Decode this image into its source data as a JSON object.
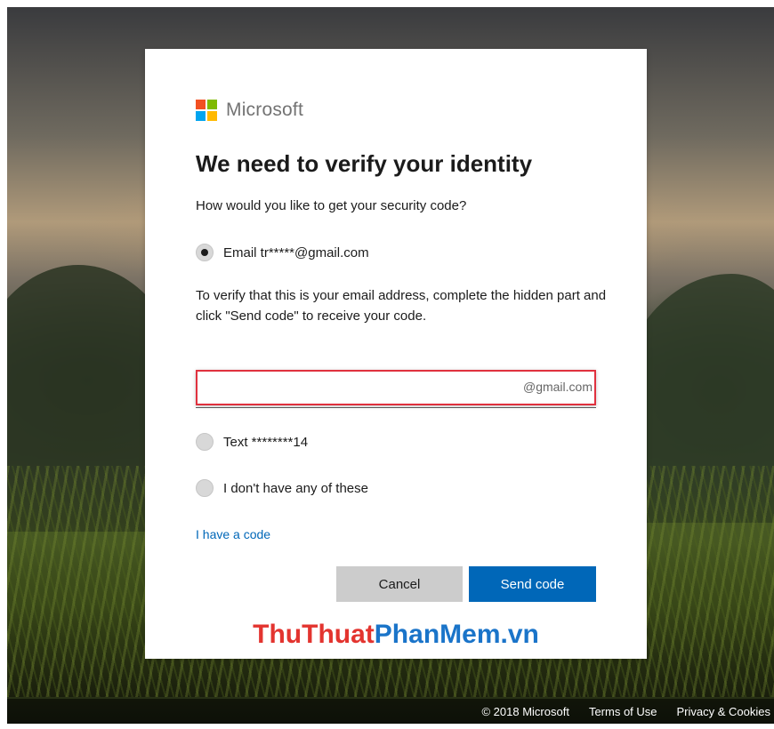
{
  "footer": {
    "copyright": "© 2018 Microsoft",
    "terms": "Terms of Use",
    "privacy": "Privacy & Cookies"
  },
  "brand": {
    "name": "Microsoft",
    "colors": [
      "#f25022",
      "#7fba00",
      "#00a4ef",
      "#ffb900"
    ]
  },
  "dialog": {
    "title": "We need to verify your identity",
    "subtitle": "How would you like to get your security code?",
    "options": [
      {
        "label": "Email tr*****@gmail.com",
        "selected": true
      },
      {
        "label": "Text ********14",
        "selected": false
      },
      {
        "label": "I don't have any of these",
        "selected": false
      }
    ],
    "instructions": "To verify that this is your email address, complete the hidden part and click \"Send code\" to receive your code.",
    "email_input": {
      "value": "",
      "suffix": "@gmail.com"
    },
    "have_code_link": "I have a code",
    "cancel_label": "Cancel",
    "send_label": "Send code"
  },
  "watermark": {
    "part1": "ThuThuat",
    "part2": "PhanMem.vn",
    "colors": [
      "#e3342f",
      "#1a74c9"
    ]
  },
  "accent_color": "#0067b8",
  "highlight_color": "#e0313e"
}
